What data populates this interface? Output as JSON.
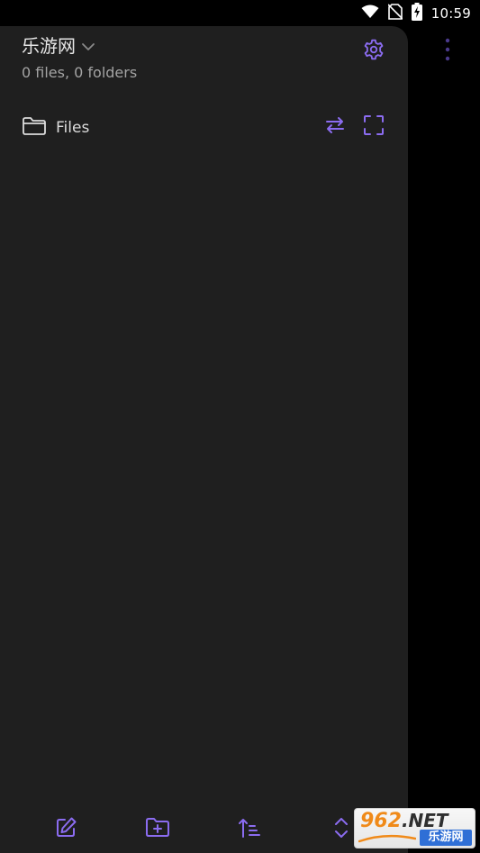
{
  "status_bar": {
    "time": "10:59",
    "icons": [
      "wifi-icon",
      "no-sim-icon",
      "battery-charging-icon"
    ]
  },
  "drawer": {
    "vault_name": "乐游网",
    "vault_stats": "0 files, 0 folders",
    "settings_icon": "gear-icon",
    "files_section": {
      "label": "Files",
      "icon": "folder-icon",
      "actions": [
        "swap-arrows-icon",
        "expand-icon"
      ]
    },
    "toolbar": [
      "new-note-icon",
      "new-folder-icon",
      "sort-icon",
      "collapse-expand-icon"
    ]
  },
  "overflow_menu_icon": "more-vertical-icon",
  "watermark": {
    "top_number": "962",
    "top_suffix": ".NET",
    "bottom_text": "乐游网"
  },
  "colors": {
    "accent": "#8b6cf0",
    "drawer_bg": "#1f1f1f",
    "background": "#000000",
    "text_primary": "#e6e6e6",
    "text_secondary": "#a3a3a3"
  }
}
